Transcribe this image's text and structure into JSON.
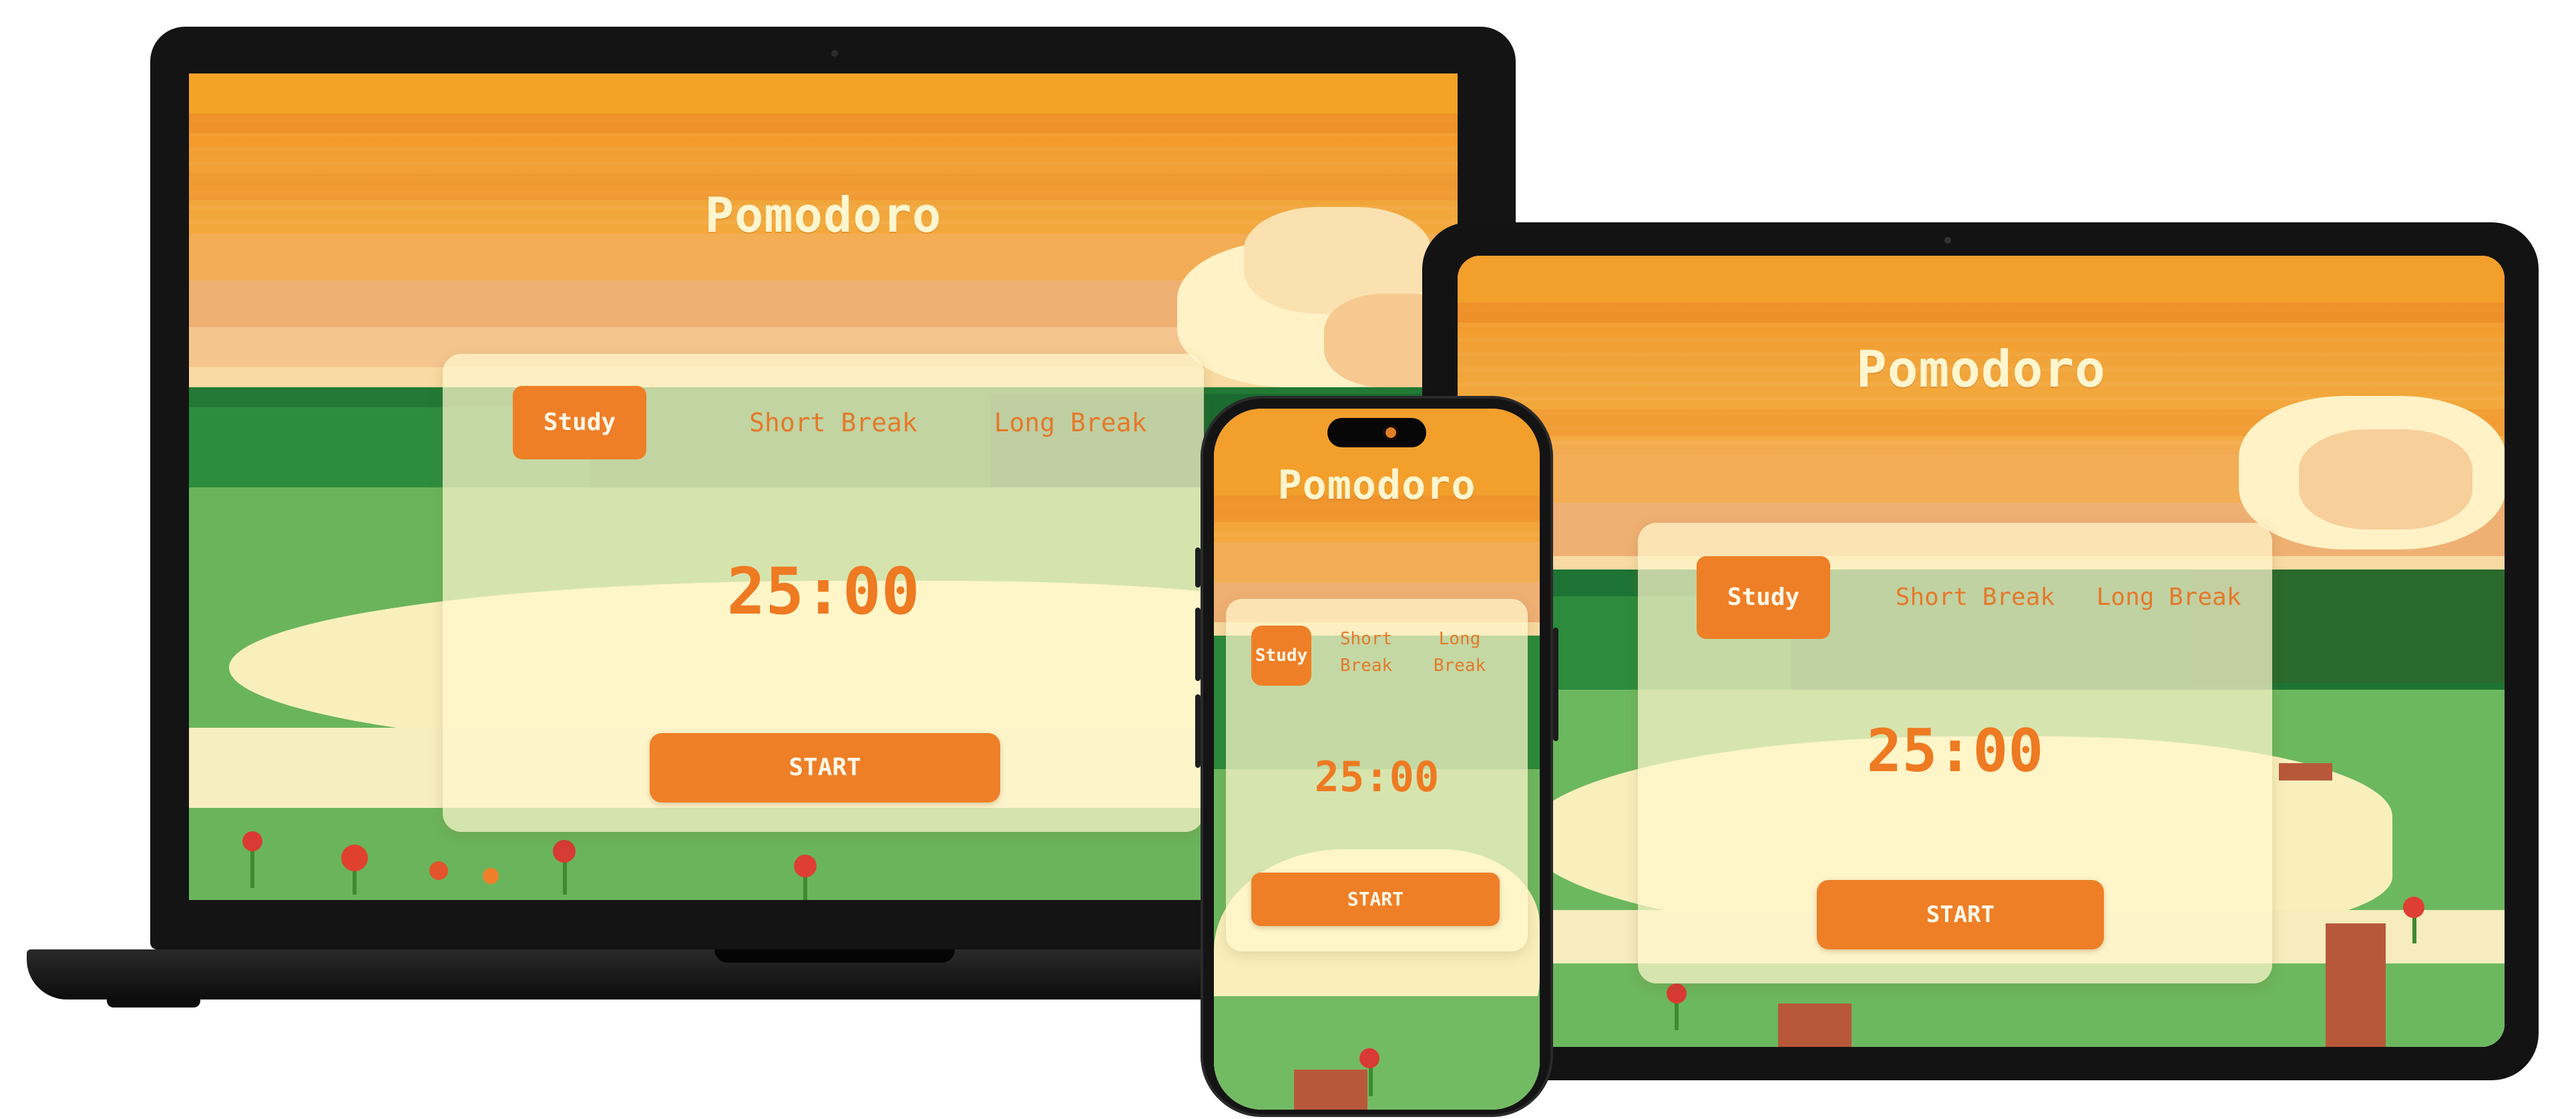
{
  "app": {
    "title": "Pomodoro",
    "tabs": {
      "study": "Study",
      "short_break": "Short Break",
      "long_break": "Long Break"
    },
    "phone_tabs": {
      "study": "Study",
      "short_line1": "Short",
      "short_line2": "Break",
      "long_line1": "Long",
      "long_line2": "Break"
    },
    "timer": "25:00",
    "start_label": "START",
    "active_tab": "Study"
  },
  "colors": {
    "accent": "#ee7f27",
    "accent_text": "#fff8e8",
    "title_text": "#fff6cf",
    "card_bg": "#fff6cd",
    "sky": "#f3a22c",
    "grass": "#6cb85e",
    "hills": "#1f7a34",
    "river": "#fbf2c4",
    "device_frame": "#141414"
  },
  "icons": {
    "laptop_camera": "camera-dot-icon",
    "phone_island": "dynamic-island-icon"
  }
}
